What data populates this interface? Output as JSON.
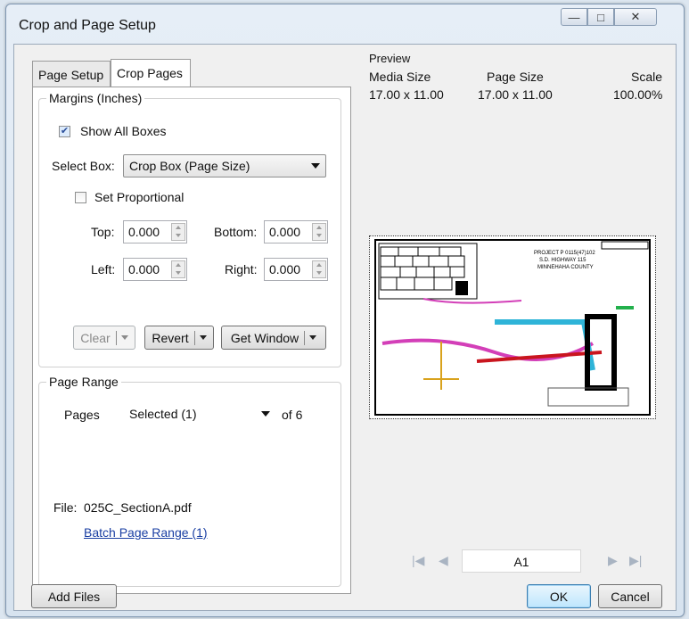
{
  "window": {
    "title": "Crop and Page Setup"
  },
  "tabs": [
    {
      "label": "Page Setup"
    },
    {
      "label": "Crop Pages"
    }
  ],
  "margins": {
    "group_label": "Margins (Inches)",
    "show_all_boxes_label": "Show All Boxes",
    "show_all_boxes_checked": true,
    "select_box_label": "Select Box:",
    "select_box_value": "Crop Box (Page Size)",
    "set_proportional_label": "Set Proportional",
    "set_proportional_checked": false,
    "top_label": "Top:",
    "top_value": "0.000",
    "bottom_label": "Bottom:",
    "bottom_value": "0.000",
    "left_label": "Left:",
    "left_value": "0.000",
    "right_label": "Right:",
    "right_value": "0.000",
    "clear_label": "Clear",
    "revert_label": "Revert",
    "get_window_label": "Get Window"
  },
  "page_range": {
    "group_label": "Page Range",
    "pages_label": "Pages",
    "pages_value": "Selected (1)",
    "of_label": "of 6",
    "file_label": "File:",
    "file_value": "025C_SectionA.pdf",
    "batch_link": "Batch Page Range (1)"
  },
  "preview": {
    "heading": "Preview",
    "media_size_label": "Media Size",
    "media_size_value": "17.00 x 11.00",
    "page_size_label": "Page Size",
    "page_size_value": "17.00 x 11.00",
    "scale_label": "Scale",
    "scale_value": "100.00%",
    "thumbnail_text": {
      "line1": "PROJECT P 0115(47)102",
      "line2": "S.D. HIGHWAY 115",
      "line3": "MINNEHAHA COUNTY"
    },
    "current_page": "A1"
  },
  "footer": {
    "add_files_label": "Add Files",
    "ok_label": "OK",
    "cancel_label": "Cancel"
  }
}
